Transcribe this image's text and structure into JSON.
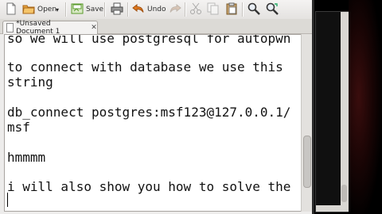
{
  "toolbar": {
    "open_label": "Open",
    "save_label": "Save",
    "undo_label": "Undo"
  },
  "tab": {
    "title": "*Unsaved Document 1",
    "close_glyph": "✕"
  },
  "document": {
    "lines": [
      "so we will use postgresql for autopwn",
      "",
      "to connect with database we use this",
      "string",
      "",
      "db_connect postgres:msf123@127.0.0.1/",
      "msf",
      "",
      "hmmmm",
      "",
      "i will also show you how to solve the"
    ]
  },
  "colors": {
    "accent": "#e07a1f",
    "save_green": "#5a9a2c"
  },
  "icons": [
    "new-document-icon",
    "open-folder-icon",
    "save-icon",
    "print-icon",
    "undo-icon",
    "redo-icon",
    "cut-icon",
    "copy-icon",
    "paste-icon",
    "find-icon",
    "find-replace-icon"
  ]
}
